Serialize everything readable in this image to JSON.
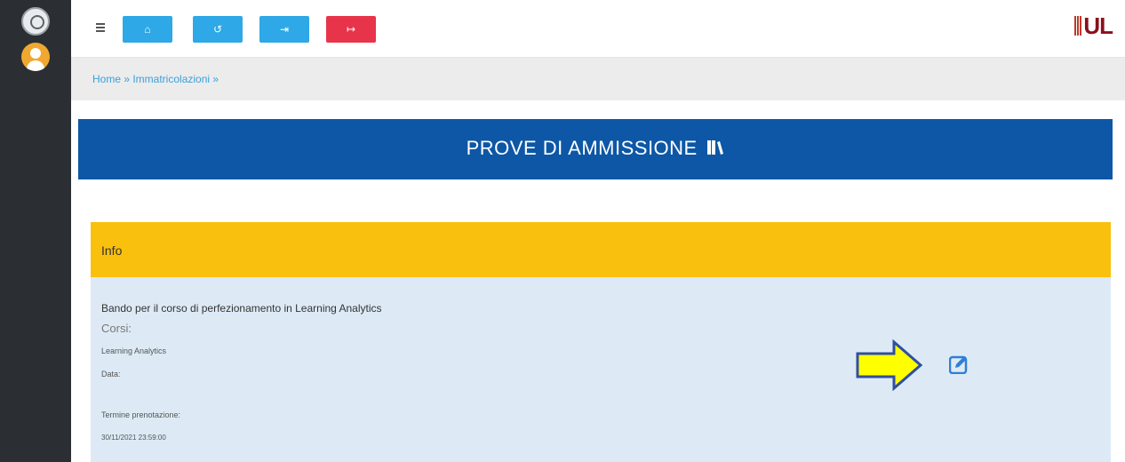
{
  "topbar": {
    "buttons": [
      {
        "icon": "home-icon",
        "glyph": "⌂",
        "color": "#2ea8e6"
      },
      {
        "icon": "undo-icon",
        "glyph": "↺",
        "color": "#2ea8e6"
      },
      {
        "icon": "login-icon",
        "glyph": "⇥",
        "color": "#2ea8e6"
      },
      {
        "icon": "logout-icon",
        "glyph": "↦",
        "color": "#e8344a"
      }
    ],
    "logo_text": "UL"
  },
  "breadcrumb": "Home » Immatricolazioni »",
  "banner": {
    "title": "PROVE DI AMMISSIONE",
    "color": "#0d57a6"
  },
  "info": {
    "title": "Info",
    "header_color": "#fac00e",
    "bando": "Bando per il corso di perfezionamento in Learning Analytics",
    "corsi_label": "Corsi:",
    "corso": "Learning Analytics",
    "data_label": "Data:",
    "termine_label": "Termine prenotazione:",
    "termine_value": "30/11/2021 23:59:00"
  },
  "colors": {
    "sidebar": "#2b2f33",
    "accent": "#2ea8e6",
    "danger": "#e8344a",
    "arrow_fill": "#ffff00",
    "arrow_stroke": "#2f4fa0"
  }
}
